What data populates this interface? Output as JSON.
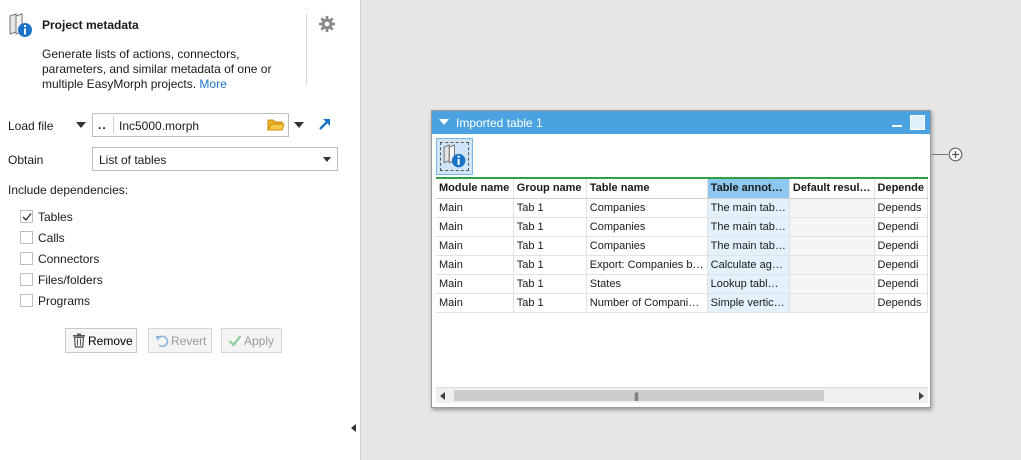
{
  "panel": {
    "title": "Project metadata",
    "description": "Generate lists of actions, connectors, parameters, and similar metadata of one or multiple EasyMorph projects.",
    "more_link": "More",
    "header_icon": "project-metadata-icon",
    "settings_icon": "gear-icon"
  },
  "load_file": {
    "label": "Load file",
    "prefix": "..",
    "value": "Inc5000.morph"
  },
  "obtain": {
    "label": "Obtain",
    "value": "List of tables"
  },
  "dependencies": {
    "label": "Include dependencies:",
    "items": [
      {
        "label": "Tables",
        "checked": true
      },
      {
        "label": "Calls",
        "checked": false
      },
      {
        "label": "Connectors",
        "checked": false
      },
      {
        "label": "Files/folders",
        "checked": false
      },
      {
        "label": "Programs",
        "checked": false
      }
    ]
  },
  "buttons": {
    "remove": "Remove",
    "revert": "Revert",
    "apply": "Apply"
  },
  "table_window": {
    "title": "Imported table 1",
    "columns": [
      "Module name",
      "Group name",
      "Table name",
      "Table annot…",
      "Default resul…",
      "Depende"
    ],
    "highlight_column": 3,
    "rows": [
      [
        "Main",
        "Tab 1",
        "Companies",
        "The main tab…",
        "",
        "Depends"
      ],
      [
        "Main",
        "Tab 1",
        "Companies",
        "The main tab…",
        "",
        "Dependi"
      ],
      [
        "Main",
        "Tab 1",
        "Companies",
        "The main tab…",
        "",
        "Dependi"
      ],
      [
        "Main",
        "Tab 1",
        "Export:  Companies b…",
        "Calculate ag…",
        "",
        "Dependi"
      ],
      [
        "Main",
        "Tab 1",
        "States",
        "Lookup tabl…",
        "",
        "Dependi"
      ],
      [
        "Main",
        "Tab 1",
        "Number of Compani…",
        "Simple vertic…",
        "",
        "Depends"
      ]
    ],
    "scroll_grip": "|||"
  },
  "colors": {
    "title_bar": "#4aa3e0",
    "link": "#1a73c9",
    "accent_line": "#2ea043",
    "highlight_header": "#8ec8f0"
  }
}
